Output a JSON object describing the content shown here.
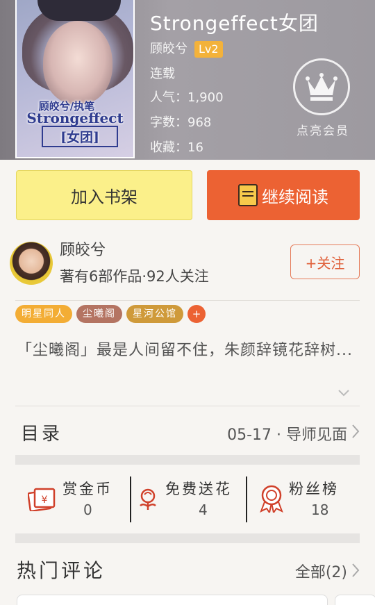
{
  "book": {
    "cover_title_line1": "顾皎兮/执笔",
    "cover_title_line2": "Strongeffect",
    "cover_title_line3": "[女团]",
    "title": "Strongeffect女团",
    "author": "顾皎兮",
    "level": "Lv2",
    "status": "连载",
    "popularity": "人气：1,900",
    "word_count": "字数：968",
    "favorites": "收藏：16"
  },
  "vip": {
    "label": "点亮会员",
    "icon": "crown-icon"
  },
  "actions": {
    "add_shelf": "加入书架",
    "continue_read": "继续阅读"
  },
  "author_card": {
    "name": "顾皎兮",
    "stats": "著有6部作品·92人关注",
    "follow": "+关注"
  },
  "tags": [
    {
      "label": "明星同人",
      "color": "#f3ad35"
    },
    {
      "label": "尘曦阁",
      "color": "#b47462"
    },
    {
      "label": "星河公馆",
      "color": "#cf9a3a"
    }
  ],
  "tag_more": "+",
  "intro_text": "「尘曦阁」最是人间留不住，朱颜辞镜花辞树...",
  "catalog": {
    "label": "目录",
    "latest": "05-17 · 导师见面"
  },
  "rewards": [
    {
      "label": "赏金币",
      "value": "0",
      "icon": "coin-envelope-icon"
    },
    {
      "label": "免费送花",
      "value": "4",
      "icon": "flower-icon"
    },
    {
      "label": "粉丝榜",
      "value": "18",
      "icon": "ribbon-medal-icon"
    }
  ],
  "comments": {
    "title": "热门评论",
    "all": "全部(2)"
  },
  "colors": {
    "accent": "#ec6233",
    "shelf_yellow": "#fbf08a",
    "level_gold": "#f3b23a"
  }
}
